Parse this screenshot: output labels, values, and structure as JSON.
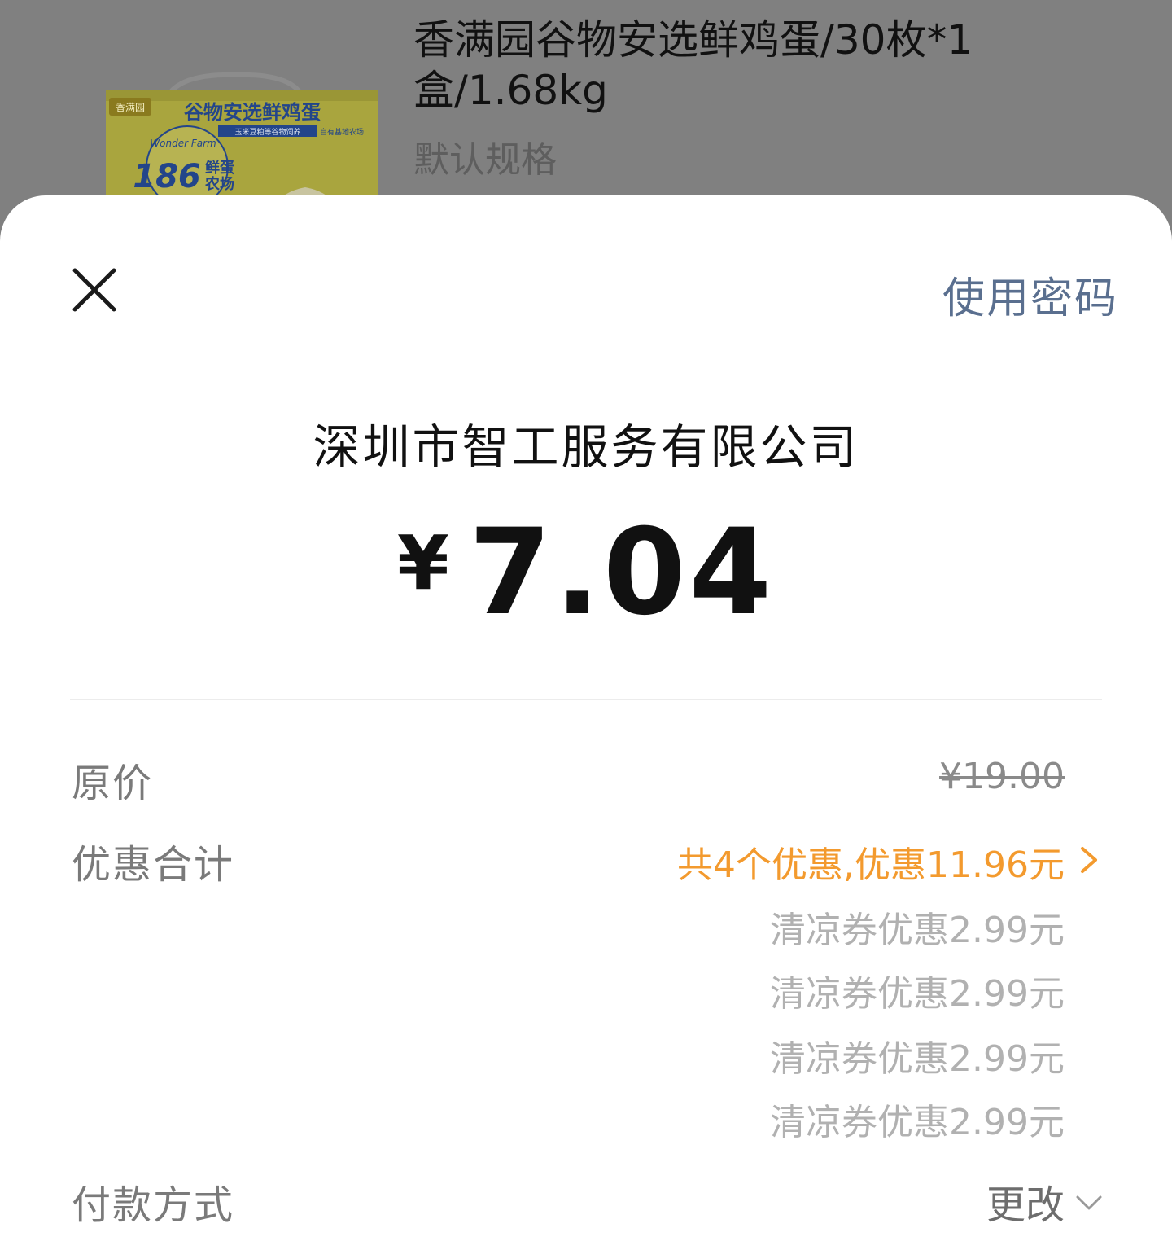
{
  "product": {
    "title": "香满园谷物安选鲜鸡蛋/30枚*1盒/1.68kg",
    "spec": "默认规格",
    "image": {
      "brand": "香满园",
      "headline": "谷物安选鲜鸡蛋",
      "banner": "玉米豆粕等谷物饲养",
      "banner2": "自有基地农场",
      "badge_number": "186",
      "badge_text1": "鲜蛋",
      "badge_text2": "农场",
      "wonder_farm": "Wonder Farm"
    }
  },
  "sheet": {
    "close_icon": "close-icon",
    "use_password_label": "使用密码",
    "merchant": "深圳市智工服务有限公司",
    "currency": "¥",
    "amount": "7.04",
    "original_price_label": "原价",
    "original_price": "¥19.00",
    "discount_label": "优惠合计",
    "discount_summary": "共4个优惠,优惠11.96元",
    "coupons": [
      "清凉券优惠2.99元",
      "清凉券优惠2.99元",
      "清凉券优惠2.99元",
      "清凉券优惠2.99元"
    ],
    "payment_label": "付款方式",
    "change_label": "更改"
  },
  "colors": {
    "overlay": "#808080",
    "link_blue": "#5a6f8f",
    "discount_orange": "#f39a2e",
    "muted_gray": "#b1b1b1"
  }
}
